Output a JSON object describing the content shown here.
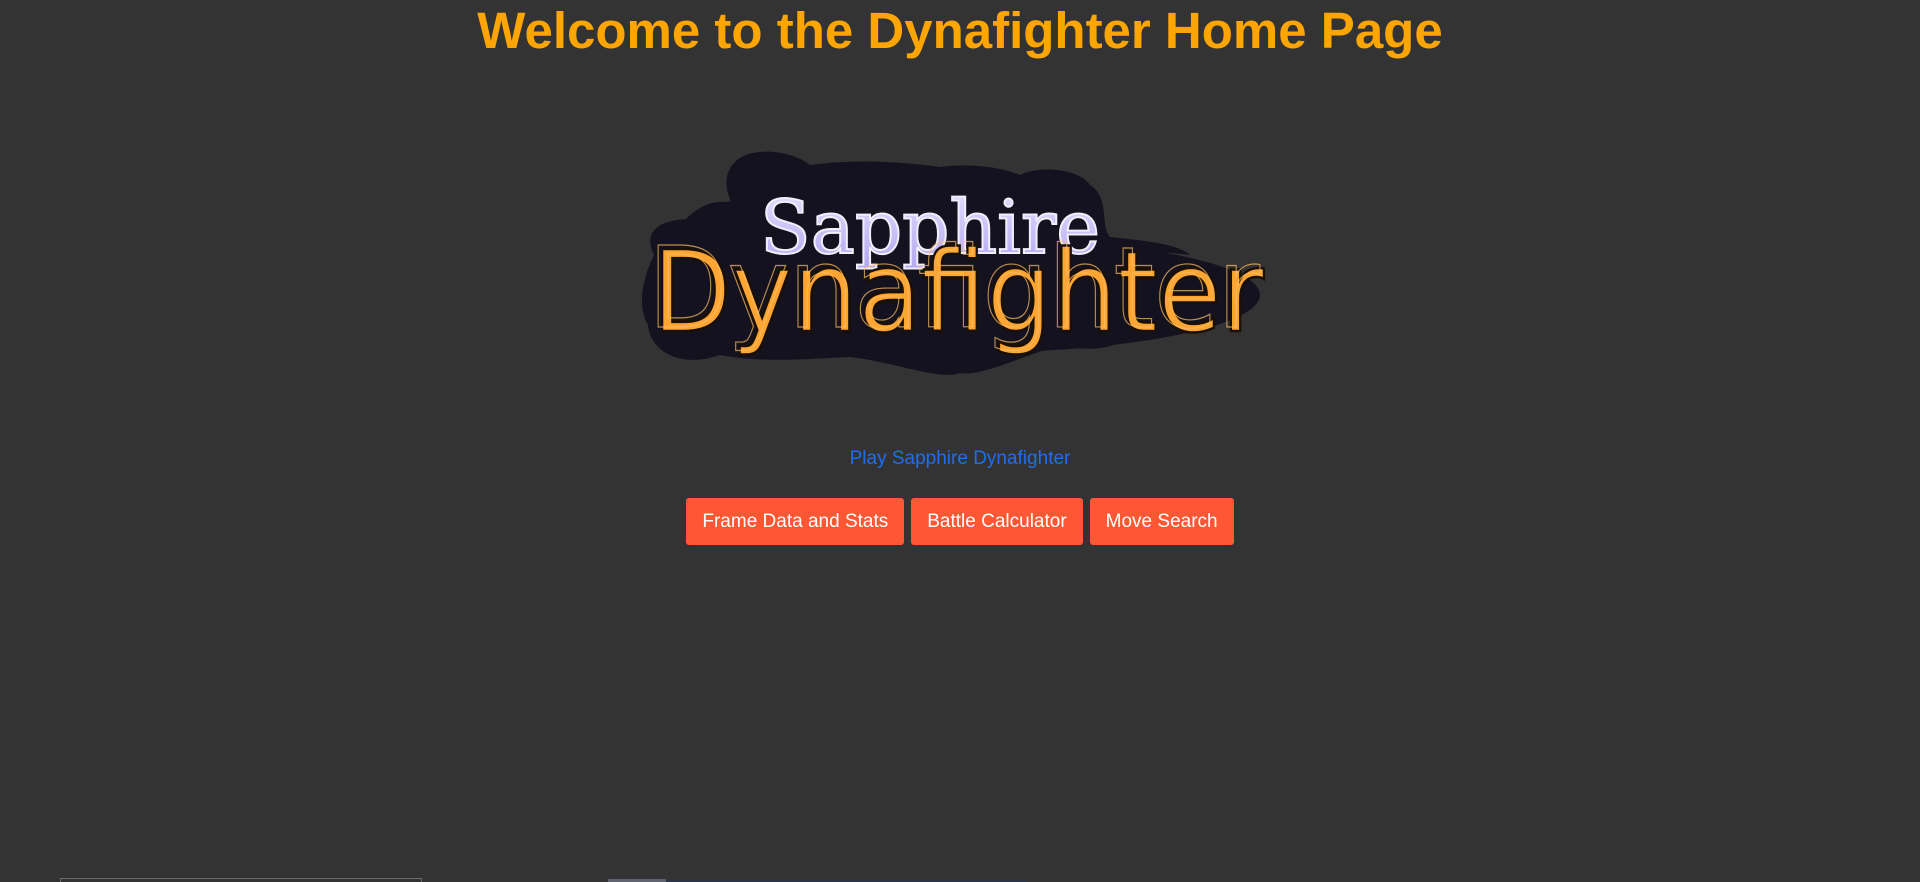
{
  "page": {
    "title": "Welcome to the Dynafighter Home Page"
  },
  "logo": {
    "line1": "Sapphire",
    "line2": "Dynafighter",
    "colors": {
      "backdrop": "#15121F",
      "sapphire_fill": "#C7BFF5",
      "dynafighter_fill": "#FFA533",
      "dynafighter_outline": "#1A1000"
    }
  },
  "links": {
    "play": "Play Sapphire Dynafighter"
  },
  "buttons": [
    {
      "label": "Frame Data and Stats"
    },
    {
      "label": "Battle Calculator"
    },
    {
      "label": "Move Search"
    }
  ],
  "colors": {
    "background": "#333333",
    "title": "#FFA500",
    "link": "#1E6EF0",
    "button_bg": "#FF5733",
    "button_text": "#FFFFFF"
  }
}
